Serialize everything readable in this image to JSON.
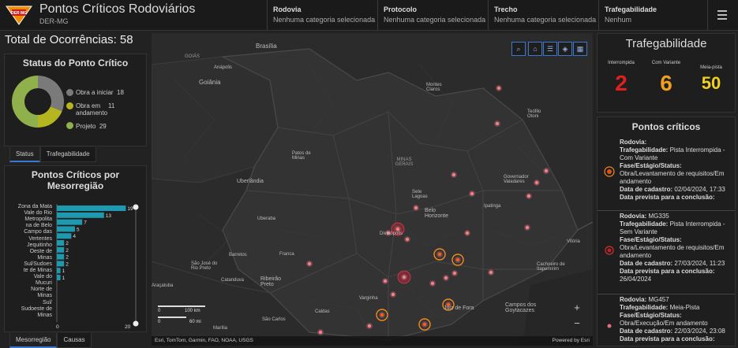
{
  "header": {
    "title": "Pontos Críticos Rodoviários",
    "subtitle": "DER-MG",
    "logo_text": "DER MG",
    "filters": [
      {
        "label": "Rodovia",
        "value": "Nenhuma categoria selecionada"
      },
      {
        "label": "Protocolo",
        "value": "Nenhuma categoria selecionada"
      },
      {
        "label": "Trecho",
        "value": "Nenhuma categoria selecionada"
      },
      {
        "label": "Trafegabilidade",
        "value": "Nenhum"
      }
    ]
  },
  "total": "Total de Ocorrências: 58",
  "status_panel": {
    "title": "Status do Ponto Crítico",
    "legend": [
      {
        "label": "Obra a iniciar",
        "value": "18",
        "color": "#7a7a7a"
      },
      {
        "label": "Obra em andamento",
        "value": "11",
        "color": "#b5b522"
      },
      {
        "label": "Projeto",
        "value": "29",
        "color": "#8fb04a"
      }
    ],
    "tabs": [
      "Status",
      "Trafegabilidade"
    ]
  },
  "meso_panel": {
    "title": "Pontos Críticos por Mesorregião",
    "tabs": [
      "Mesorregião",
      "Causas"
    ]
  },
  "chart_data": {
    "type": "bar",
    "orientation": "horizontal",
    "categories": [
      "Zona da Mata",
      "Vale do Rio Doce",
      "Metropolitana de Belo Horizonte",
      "Campo das Vertentes",
      "Jequitinhonha",
      "Oeste de Minas",
      "Sul/Sudoeste de Minas",
      "Vale do Mucuri",
      "Norte de Minas",
      "Sul",
      "Sudoeste de Minas"
    ],
    "category_labels": [
      "Zona da Mata",
      "Vale do Rio",
      "Metropolita",
      "na de Belo",
      "Campo das",
      "Vertentes",
      "Jequitinho",
      "Oeste de",
      "Minas",
      "Sul/Sudoes",
      "te de Minas",
      "Vale do",
      "Mucuri",
      "Norte de",
      "Minas",
      "Sul/",
      "Sudoeste de",
      "Minas"
    ],
    "values": [
      19,
      13,
      7,
      5,
      4,
      2,
      2,
      2,
      2,
      1,
      1
    ],
    "xlim": [
      0,
      20
    ],
    "xticks": [
      "0",
      "20"
    ],
    "color": "#1e9ab0"
  },
  "map": {
    "state_label": "MINAS GERAIS",
    "region_labels": [
      "GOIÁS",
      "MINAS GERAIS"
    ],
    "cities": [
      "Brasília",
      "Anápolis",
      "Goiânia",
      "Montes Claros",
      "Teófilo Otoni",
      "Patos de Minas",
      "Uberlândia",
      "Governador Valadares",
      "Sete Lagoas",
      "Belo Horizonte",
      "Ipatinga",
      "Divinópolis",
      "Uberaba",
      "Franca",
      "Barretos",
      "São José do Rio Preto",
      "Catanduva",
      "Ribeirão Preto",
      "Araçatuba",
      "Juiz de Fora",
      "Varginha",
      "Campos dos Goytacazes",
      "São Carlos",
      "Caldas",
      "Cachoeiro de Itapemirim",
      "Vitória",
      "Marília"
    ],
    "tools": [
      "search-icon",
      "home-icon",
      "list-icon",
      "layers-icon",
      "qr-icon"
    ],
    "scale_km": "100 km",
    "scale_mi": "60 mi",
    "scale_zero": "0",
    "attribution": "Esri, TomTom, Garmin, FAO, NOAA, USGS",
    "powered": "Powered by Esri",
    "zoom_in": "+",
    "zoom_out": "−"
  },
  "traf_panel": {
    "title": "Trafegabilidade",
    "items": [
      {
        "label": "Interrompida",
        "value": "2",
        "color": "#e02020"
      },
      {
        "label": "Com Variante",
        "value": "6",
        "color": "#f0a020"
      },
      {
        "label": "Meia-pista",
        "value": "50",
        "color": "#f0d020"
      }
    ]
  },
  "points_panel": {
    "title": "Pontos críticos",
    "items": [
      {
        "rodovia": "Rodovia:",
        "rodovia_val": "",
        "traf": "Trafegabilidade:",
        "traf_val": "Pista Interrompida - Com Variante",
        "fase": "Fase/Estágio/Status:",
        "fase_val": "Obra/Levantamento de requisitos/Em andamento",
        "data": "Data de cadastro:",
        "data_val": "02/04/2024, 17:33",
        "prev": "Data prevista para a conclusão:",
        "prev_val": ""
      },
      {
        "rodovia": "Rodovia:",
        "rodovia_val": "MG335",
        "traf": "Trafegabilidade:",
        "traf_val": "Pista Interrompida - Sem Variante",
        "fase": "Fase/Estágio/Status:",
        "fase_val": "Obra/Levantamento de requisitos/Em andamento",
        "data": "Data de cadastro:",
        "data_val": "27/03/2024, 11:23",
        "prev": "Data prevista para a conclusão:",
        "prev_val": "26/04/2024"
      },
      {
        "rodovia": "Rodovia:",
        "rodovia_val": "MG457",
        "traf": "Trafegabilidade:",
        "traf_val": "Meia-Pista",
        "fase": "Fase/Estágio/Status:",
        "fase_val": "Obra/Execução/Em andamento",
        "data": "Data de cadastro:",
        "data_val": "22/03/2024, 23:08",
        "prev": "Data prevista para a conclusão:",
        "prev_val": ""
      }
    ]
  }
}
